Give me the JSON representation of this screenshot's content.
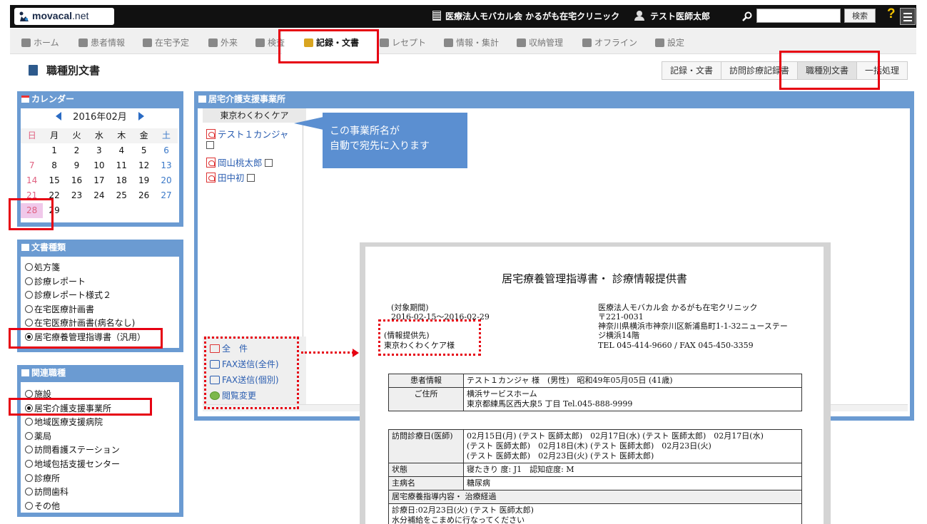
{
  "header": {
    "logo_text": "movacal",
    "logo_suffix": ".net",
    "clinic": "医療法人モバカル会 かるがも在宅クリニック",
    "doctor": "テスト医師太郎",
    "search_placeholder": "",
    "search_button": "検索",
    "help": "?"
  },
  "nav": {
    "items": [
      {
        "label": "ホーム",
        "icon": "home-icon"
      },
      {
        "label": "患者情報",
        "icon": "patient-icon"
      },
      {
        "label": "在宅予定",
        "icon": "clock-icon"
      },
      {
        "label": "外来",
        "icon": "person-icon"
      },
      {
        "label": "検査",
        "icon": "chart-icon"
      },
      {
        "label": "記録・文書",
        "icon": "document-icon"
      },
      {
        "label": "レセプト",
        "icon": "receipt-icon"
      },
      {
        "label": "情報・集計",
        "icon": "stats-icon"
      },
      {
        "label": "収納管理",
        "icon": "money-icon"
      },
      {
        "label": "オフライン",
        "icon": "offline-icon"
      },
      {
        "label": "設定",
        "icon": "gear-icon"
      }
    ],
    "active": "記録・文書"
  },
  "page": {
    "title": "職種別文書",
    "subtabs": [
      "記録・文書",
      "訪問診療記録書",
      "職種別文書",
      "一括処理"
    ],
    "active_subtab": "職種別文書"
  },
  "calendar": {
    "title": "カレンダー",
    "month": "2016年02月",
    "weekdays": [
      "日",
      "月",
      "火",
      "水",
      "木",
      "金",
      "土"
    ],
    "weeks": [
      [
        "",
        "1",
        "2",
        "3",
        "4",
        "5",
        "6"
      ],
      [
        "7",
        "8",
        "9",
        "10",
        "11",
        "12",
        "13"
      ],
      [
        "14",
        "15",
        "16",
        "17",
        "18",
        "19",
        "20"
      ],
      [
        "21",
        "22",
        "23",
        "24",
        "25",
        "26",
        "27"
      ],
      [
        "28",
        "29",
        "",
        "",
        "",
        "",
        ""
      ]
    ],
    "today": "28"
  },
  "doc_types": {
    "title": "文書種類",
    "items": [
      "処方箋",
      "診療レポート",
      "診療レポート様式２",
      "在宅医療計画書",
      "在宅医療計画書(病名なし)",
      "居宅療養管理指導書（汎用）"
    ],
    "selected": 5
  },
  "occupations": {
    "title": "関連職種",
    "items": [
      "施設",
      "居宅介護支援事業所",
      "地域医療支援病院",
      "薬局",
      "訪問看護ステーション",
      "地域包括支援センター",
      "診療所",
      "訪問歯科",
      "その他"
    ],
    "selected": 1
  },
  "main_panel": {
    "title": "居宅介護支援事業所",
    "tab": "東京わくわくケア",
    "files": [
      "テスト１カンジャ",
      "岡山桃太郎",
      "田中初"
    ],
    "actions": [
      "全　件",
      "FAX送信(全件)",
      "FAX送信(個別)",
      "閲覧変更"
    ]
  },
  "callout": {
    "line1": "この事業所名が",
    "line2": "自動で宛先に入ります"
  },
  "document": {
    "title": "居宅療養管理指導書・ 診療情報提供書",
    "period_label": "(対象期間)",
    "period": "2016-02-15～2016-02-29",
    "recipient_label": "(情報提供先)",
    "recipient": "東京わくわくケア様",
    "clinic_name": "医療法人モバカル会 かるがも在宅クリニック",
    "zip": "〒221-0031",
    "address1": "神奈川県横浜市神奈川区新浦島町1-1-32ニューステー",
    "address2": "ジ横浜14階",
    "tel": "TEL 045-414-9660 / FAX 045-450-3359",
    "patient_label": "患者情報",
    "patient": "テスト１カンジャ 様　(男性)　昭和49年05月05日 (41歳)",
    "address_label": "ご住所",
    "addr_line1": "横浜サービスホーム",
    "addr_line2": "東京都練馬区西大泉5 丁目 Tel.045-888-9999",
    "visit_label": "訪問診療日(医師)",
    "visit_line1": "02月15日(月) (テスト 医師太郎)　02月17日(水) (テスト 医師太郎)　02月17日(水)",
    "visit_line2": "(テスト 医師太郎)　02月18日(木) (テスト 医師太郎)　02月23日(火)",
    "visit_line3": "(テスト 医師太郎)　02月23日(火) (テスト 医師太郎)",
    "state_label": "状態",
    "state": "寝たきり 度: J1　認知症度: M",
    "disease_label": "主病名",
    "disease": "糖尿病",
    "guidance_label": "居宅療養指導内容・ 治療経過",
    "guidance_line1": "診療日:02月23日(火) (テスト 医師太郎)",
    "guidance_line2": "水分補給をこまめに行なってください"
  }
}
